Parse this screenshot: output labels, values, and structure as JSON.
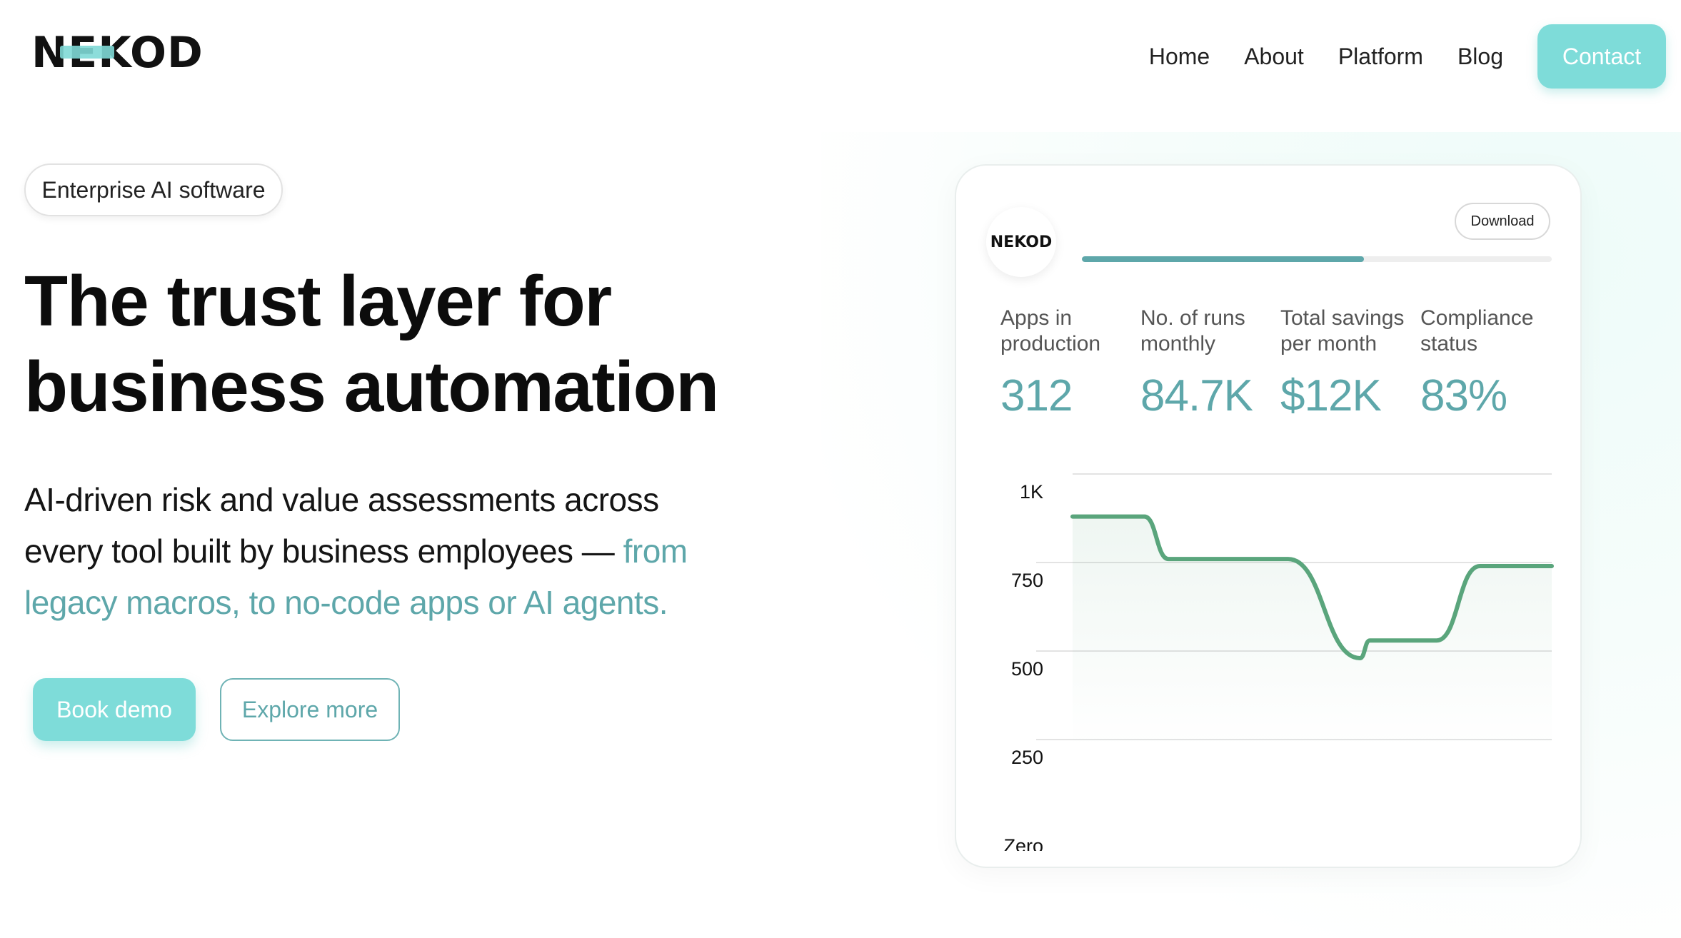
{
  "brand": {
    "logo_text": "NEKOD"
  },
  "nav": {
    "links": [
      "Home",
      "About",
      "Platform",
      "Blog"
    ],
    "contact_label": "Contact"
  },
  "hero": {
    "pill": "Enterprise AI software",
    "headline_line1": "The trust layer for",
    "headline_line2": "business automation",
    "sub_plain": "AI-driven risk and value assessments across every tool built by business employees — ",
    "sub_accent": "from legacy macros, to no-code apps or AI agents.",
    "book_demo": "Book demo",
    "explore_more": "Explore more"
  },
  "dashboard": {
    "mini_logo": "NEKOD",
    "download_label": "Download",
    "progress": 0.6,
    "stats": [
      {
        "label_l1": "Apps in",
        "label_l2": "production",
        "value": "312"
      },
      {
        "label_l1": "No. of runs",
        "label_l2": "monthly",
        "value": "84.7K"
      },
      {
        "label_l1": "Total savings",
        "label_l2": "per month",
        "value": "$12K"
      },
      {
        "label_l1": "Compliance",
        "label_l2": "status",
        "value": "83%"
      }
    ]
  },
  "colors": {
    "accent": "#5ea7aa",
    "button": "#7edcd9",
    "line": "#5aa57c"
  },
  "chart_data": {
    "type": "line",
    "y_tick_labels": [
      "1K",
      "750",
      "500",
      "250",
      "Zero"
    ],
    "ylim": [
      0,
      1000
    ],
    "x": [
      0,
      0.15,
      0.2,
      0.45,
      0.6,
      0.76,
      0.85,
      1.0
    ],
    "values": [
      900,
      900,
      780,
      780,
      550,
      550,
      760,
      760
    ],
    "series": [
      {
        "x": [
          0,
          0.15,
          0.2,
          0.45,
          0.6,
          0.62,
          0.76,
          0.85,
          1.0
        ],
        "values": [
          900,
          900,
          780,
          780,
          500,
          550,
          550,
          760,
          760
        ]
      }
    ],
    "grid": true
  }
}
